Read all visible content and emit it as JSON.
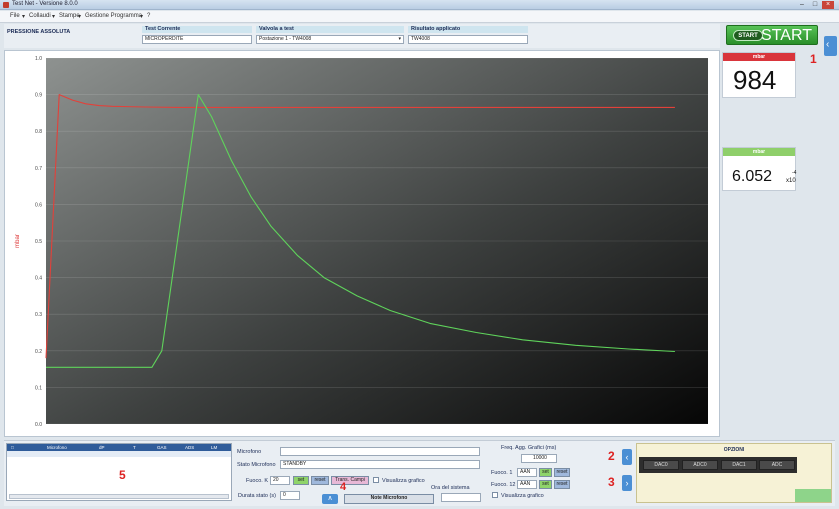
{
  "window": {
    "title": "Test Net - Versione 8.0.0",
    "menu": [
      "File",
      "Collaudi",
      "Stampe",
      "Gestione Programma",
      "?"
    ]
  },
  "info": {
    "test_type": "PRESSIONE ASSOLUTA",
    "test_label": "Test Corrente",
    "test_value": "MICROPERDITE",
    "valve_label": "Valvola a test",
    "valve_value": "Postazione 1 - TW4008",
    "result_label": "Risultato applicato",
    "result_value": "TW4008"
  },
  "start_button": {
    "badge": "START",
    "label": "START"
  },
  "readout1": {
    "header": "mbar",
    "value": "984",
    "marker": "1"
  },
  "readout2": {
    "header": "mbar",
    "value": "6.052",
    "exponent_base": "x10",
    "exponent": "-4"
  },
  "chart_data": {
    "type": "line",
    "ylabel": "mbar",
    "ylim": [
      0,
      1.0
    ],
    "yticks": [
      "0.0",
      "0.1",
      "0.2",
      "0.3",
      "0.4",
      "0.5",
      "0.6",
      "0.7",
      "0.8",
      "0.9",
      "1.0"
    ],
    "xlim": [
      0,
      100
    ],
    "series": [
      {
        "color": "#e2413a",
        "x": [
          0,
          2,
          4,
          6,
          8,
          10,
          15,
          20,
          30,
          50,
          75,
          95
        ],
        "y": [
          0.18,
          0.9,
          0.885,
          0.875,
          0.87,
          0.868,
          0.866,
          0.865,
          0.865,
          0.865,
          0.865,
          0.865
        ]
      },
      {
        "color": "#5fd35b",
        "x": [
          0,
          16,
          17.5,
          23,
          25,
          28,
          31,
          34,
          38,
          42,
          47,
          52,
          58,
          65,
          72,
          80,
          88,
          95
        ],
        "y": [
          0.155,
          0.155,
          0.2,
          0.9,
          0.84,
          0.72,
          0.62,
          0.54,
          0.46,
          0.4,
          0.35,
          0.31,
          0.275,
          0.25,
          0.23,
          0.215,
          0.205,
          0.198
        ]
      }
    ]
  },
  "bottom": {
    "table_headers": [
      "Microfono",
      "dP",
      "T",
      "GAS",
      "ADS",
      "LM"
    ],
    "table_marker": "5",
    "microfono_label": "Microfono",
    "stato_label": "Stato Microfono",
    "stato_value": "STANDBY",
    "fuoco_label": "Fuoco. K",
    "fuoco_value": "20",
    "btn_set": "set",
    "btn_reset": "reset",
    "btn_trans": "Trans. Campi",
    "vis_grafico_label": "Visualizza grafico",
    "durata_label": "Durata stato (s)",
    "durata_value": "0",
    "ora_label": "Ora del sistema",
    "note_button": "Note Microfono",
    "marker4": "4",
    "freq_label": "Freq. Agg. Grafici (ms)",
    "freq_value": "10000",
    "fuoco1_label": "Fuoco. 1",
    "fuoco1_value": "AAN",
    "fuoco2_label": "Fuoco. 12",
    "fuoco2_value": "AAN",
    "vis_grafico2_label": "Visualizza grafico",
    "marker2": "2",
    "marker3": "3",
    "opz_title": "OPZIONI",
    "opz_buttons": [
      "DAC0",
      "ADC0",
      "DAC1",
      "ADC"
    ]
  },
  "colors": {
    "accent": "#2a8f2a",
    "readout1_header": "#d9353b",
    "readout2_header": "#8fcf6a",
    "marker": "#dd2222"
  },
  "icons": [
    "app-icon",
    "minimize-icon",
    "maximize-icon",
    "close-icon",
    "chevron-left-icon",
    "chevron-right-icon"
  ]
}
